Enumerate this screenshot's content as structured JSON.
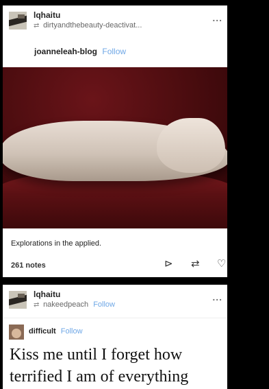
{
  "posts": [
    {
      "username": "lqhaitu",
      "reblogged_from": "dirtyandthebeauty-deactivat...",
      "source_blog": "joanneleah-blog",
      "follow_label": "Follow",
      "more_label": "...",
      "caption": "Explorations in the applied.",
      "notes": "261 notes"
    },
    {
      "username": "lqhaitu",
      "reblogged_from": "nakeedpeach",
      "follow_label": "Follow",
      "more_label": "...",
      "source_blog": "difficult",
      "source_follow_label": "Follow",
      "text_line1": "Kiss me until I forget how",
      "text_line2": "terrified I am of everything"
    }
  ],
  "icons": {
    "reblog_small": "⇄",
    "share": "⊳",
    "reblog": "⇄",
    "like": "♡"
  },
  "colors": {
    "follow": "#6ea7e6",
    "background": "#000000"
  }
}
